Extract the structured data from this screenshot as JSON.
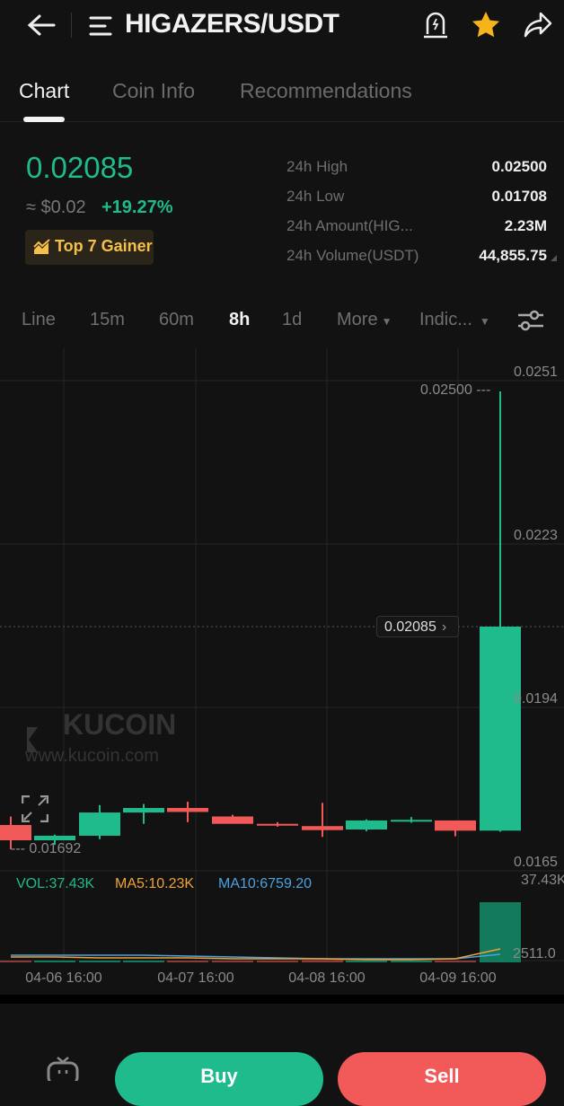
{
  "header": {
    "back_icon": "arrow-left",
    "menu_icon": "menu-lines",
    "pair": "HIGAZERS/USDT",
    "alert_icon": "price-alert-bell",
    "favorite_icon": "star-filled",
    "share_icon": "share-arrow"
  },
  "tabs": [
    {
      "label": "Chart",
      "active": true
    },
    {
      "label": "Coin Info",
      "active": false
    },
    {
      "label": "Recommendations",
      "active": false
    }
  ],
  "ticker": {
    "last_price": "0.02085",
    "fiat_approx": "≈ $0.02",
    "change_pct": "+19.27%",
    "badge": "Top 7 Gainer",
    "stats": [
      {
        "label": "24h High",
        "value": "0.02500"
      },
      {
        "label": "24h Low",
        "value": "0.01708"
      },
      {
        "label": "24h Amount(HIG...",
        "value": "2.23M"
      },
      {
        "label": "24h Volume(USDT)",
        "value": "44,855.75"
      }
    ]
  },
  "intervals": [
    {
      "label": "Line",
      "active": false
    },
    {
      "label": "15m",
      "active": false
    },
    {
      "label": "60m",
      "active": false
    },
    {
      "label": "8h",
      "active": true
    },
    {
      "label": "1d",
      "active": false
    },
    {
      "label": "More",
      "active": false,
      "dropdown": true
    },
    {
      "label": "Indic...",
      "active": false,
      "dropdown": true
    }
  ],
  "colors": {
    "up": "#1fbb8c",
    "down": "#f25a5a",
    "bg": "#121212",
    "ma5": "#f0a23a",
    "ma10": "#4aa3e0"
  },
  "chart_data": {
    "type": "candlestick",
    "interval": "8h",
    "y_ticks": [
      "0.0251",
      "0.0223",
      "0.0194",
      "0.0165"
    ],
    "ylim": [
      0.0165,
      0.0251
    ],
    "x_ticks": [
      "04-06 16:00",
      "04-07 16:00",
      "04-08 16:00",
      "04-09 16:00"
    ],
    "max_label": "0.02500",
    "min_label": "0.01692",
    "last_price_label": "0.02085",
    "watermark": {
      "brand": "KUCOIN",
      "url": "www.kucoin.com"
    },
    "candles": [
      {
        "o": 0.01735,
        "h": 0.0175,
        "l": 0.01692,
        "c": 0.01708
      },
      {
        "o": 0.01708,
        "h": 0.01718,
        "l": 0.017,
        "c": 0.01716
      },
      {
        "o": 0.01716,
        "h": 0.0177,
        "l": 0.0171,
        "c": 0.01757
      },
      {
        "o": 0.01757,
        "h": 0.01772,
        "l": 0.01737,
        "c": 0.01765
      },
      {
        "o": 0.01765,
        "h": 0.01776,
        "l": 0.0174,
        "c": 0.01758
      },
      {
        "o": 0.0175,
        "h": 0.01753,
        "l": 0.01738,
        "c": 0.01737
      },
      {
        "o": 0.01737,
        "h": 0.0174,
        "l": 0.01732,
        "c": 0.01736
      },
      {
        "o": 0.01733,
        "h": 0.01774,
        "l": 0.01714,
        "c": 0.01726
      },
      {
        "o": 0.01727,
        "h": 0.01745,
        "l": 0.01724,
        "c": 0.01743
      },
      {
        "o": 0.01744,
        "h": 0.01749,
        "l": 0.01739,
        "c": 0.01744
      },
      {
        "o": 0.01743,
        "h": 0.01743,
        "l": 0.01715,
        "c": 0.01725
      },
      {
        "o": 0.01725,
        "h": 0.025,
        "l": 0.01723,
        "c": 0.02085
      }
    ],
    "volume": {
      "vol_label": "VOL:37.43K",
      "ma5_label": "MA5:10.23K",
      "ma10_label": "MA10:6759.20",
      "y_ticks": [
        "37.43K",
        "2511.0"
      ],
      "ylim": [
        0,
        37430
      ],
      "values": [
        900,
        300,
        250,
        400,
        250,
        300,
        200,
        1500,
        250,
        200,
        400,
        37430
      ]
    }
  },
  "actions": {
    "bot_icon": "trading-bot",
    "buy": "Buy",
    "sell": "Sell"
  }
}
